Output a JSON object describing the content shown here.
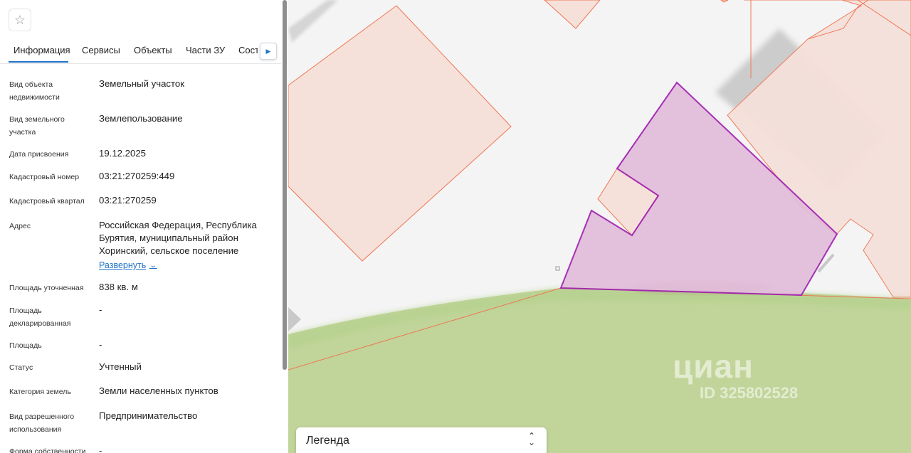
{
  "tabs": [
    "Информация",
    "Сервисы",
    "Объекты",
    "Части ЗУ",
    "Соста"
  ],
  "info_rows": [
    {
      "label": "Вид объекта недвижимости",
      "value": "Земельный участок"
    },
    {
      "label": "Вид земельного участка",
      "value": "Землепользование"
    },
    {
      "label": "Дата присвоения",
      "value": "19.12.2025"
    },
    {
      "label": "Кадастровый номер",
      "value": "03:21:270259:449"
    },
    {
      "label": "Кадастровый квартал",
      "value": "03:21:270259"
    },
    {
      "label": "Адрес",
      "value": "Российская Федерация, Республика Бурятия, муниципальный район Хоринский, сельское поселение"
    },
    {
      "label": "Площадь уточненная",
      "value": "838 кв. м"
    },
    {
      "label": "Площадь декларированная",
      "value": "-"
    },
    {
      "label": "Площадь",
      "value": "-"
    },
    {
      "label": "Статус",
      "value": "Учтенный"
    },
    {
      "label": "Категория земель",
      "value": "Земли населенных пунктов"
    },
    {
      "label": "Вид разрешенного использования",
      "value": "Предпринимательство"
    },
    {
      "label": "Форма собственности",
      "value": "-"
    }
  ],
  "expand_label": "Развернуть",
  "legend": {
    "title": "Легенда"
  },
  "watermark": {
    "logo": "циан",
    "id": "ID 325802528"
  },
  "icons": {
    "favorite": "star-icon",
    "tabs_next": "caret-right-icon",
    "expand": "chevron-down-icon",
    "legend_toggle": "expand-collapse-icon"
  },
  "colors": {
    "accent": "#1f73c7",
    "selected_parcel": "#e2bcda",
    "selected_border": "#a020b0",
    "parcel_fill": "#f6e1da",
    "parcel_border": "#ee7755",
    "green_zone": "#c1d59a"
  }
}
